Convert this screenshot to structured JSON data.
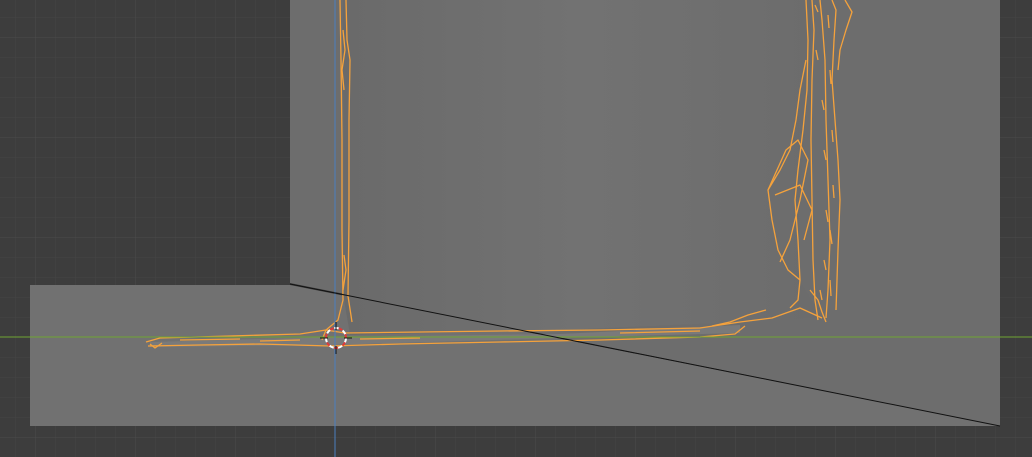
{
  "viewport": {
    "label": "",
    "colors": {
      "background": "#3d3d3d",
      "grid_minor": "#454545",
      "grid_major": "#4a4a4a",
      "floor_plane": "#6e6e6e",
      "back_wall": "#727272",
      "front_slab": "#717171",
      "scan_mesh": "#7a7a7a",
      "selection_outline": "#f5a23c",
      "x_axis": "#6fa534",
      "z_axis": "#4a7fc0",
      "camera_line": "#111111",
      "cursor_red": "#e03a3a",
      "cursor_white": "#ffffff"
    }
  },
  "objects": {
    "selected_mesh": "scanned-wall-mesh",
    "cursor": "3d-cursor",
    "axes": [
      "x-axis",
      "z-axis"
    ]
  }
}
